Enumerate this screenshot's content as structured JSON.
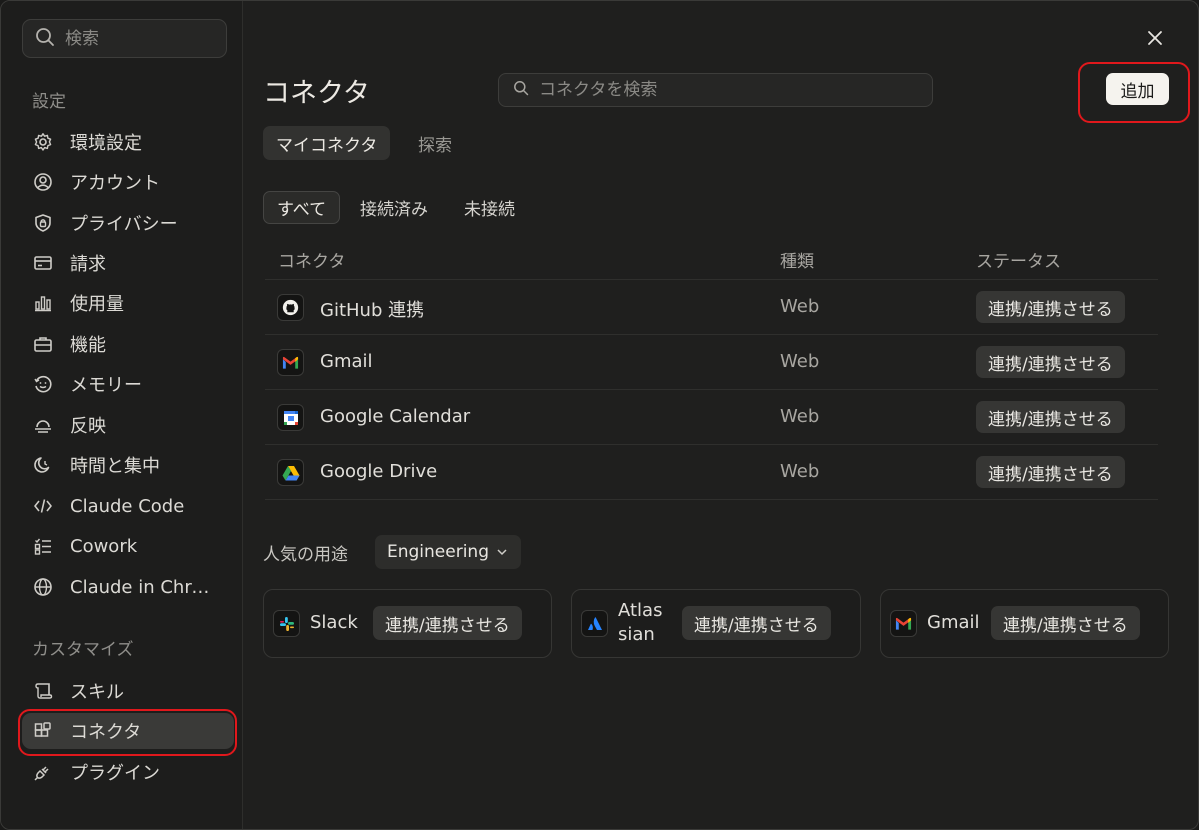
{
  "sidebar": {
    "search_placeholder": "検索",
    "section_settings": "設定",
    "items": [
      {
        "label": "環境設定",
        "icon": "gear-icon"
      },
      {
        "label": "アカウント",
        "icon": "user-circle-icon"
      },
      {
        "label": "プライバシー",
        "icon": "shield-icon"
      },
      {
        "label": "請求",
        "icon": "credit-card-icon"
      },
      {
        "label": "使用量",
        "icon": "bar-chart-icon"
      },
      {
        "label": "機能",
        "icon": "briefcase-icon"
      },
      {
        "label": "メモリー",
        "icon": "memory-icon"
      },
      {
        "label": "反映",
        "icon": "sunrise-icon"
      },
      {
        "label": "時間と集中",
        "icon": "moon-clock-icon"
      },
      {
        "label": "Claude Code",
        "icon": "code-icon"
      },
      {
        "label": "Cowork",
        "icon": "checklist-icon"
      },
      {
        "label": "Claude in Chrome",
        "icon": "globe-icon"
      }
    ],
    "section_customize": "カスタマイズ",
    "custom_items": [
      {
        "label": "スキル",
        "icon": "scroll-icon"
      },
      {
        "label": "コネクタ",
        "icon": "blocks-icon"
      },
      {
        "label": "プラグイン",
        "icon": "plug-icon"
      }
    ]
  },
  "main": {
    "title": "コネクタ",
    "search_placeholder": "コネクタを検索",
    "add_label": "追加",
    "tabs": [
      {
        "label": "マイコネクタ"
      },
      {
        "label": "探索"
      }
    ],
    "filters": [
      {
        "label": "すべて"
      },
      {
        "label": "接続済み"
      },
      {
        "label": "未接続"
      }
    ],
    "columns": {
      "connector": "コネクタ",
      "type": "種類",
      "status": "ステータス"
    },
    "rows": [
      {
        "name": "GitHub 連携",
        "type": "Web",
        "action": "連携/連携させる",
        "icon": "github-icon"
      },
      {
        "name": "Gmail",
        "type": "Web",
        "action": "連携/連携させる",
        "icon": "gmail-icon"
      },
      {
        "name": "Google Calendar",
        "type": "Web",
        "action": "連携/連携させる",
        "icon": "google-calendar-icon"
      },
      {
        "name": "Google Drive",
        "type": "Web",
        "action": "連携/連携させる",
        "icon": "google-drive-icon"
      }
    ],
    "popular_label": "人気の用途",
    "popular_dropdown": "Engineering",
    "cards": [
      {
        "name": "Slack",
        "action": "連携/連携させる",
        "icon": "slack-icon"
      },
      {
        "name_line1": "Atlas",
        "name_line2": "sian",
        "action": "連携/連携させる",
        "icon": "atlassian-icon"
      },
      {
        "name": "Gmail",
        "action": "連携/連携させる",
        "icon": "gmail-icon"
      }
    ]
  },
  "colors": {
    "highlight": "#e0181c",
    "background": "#1f1f1e"
  }
}
